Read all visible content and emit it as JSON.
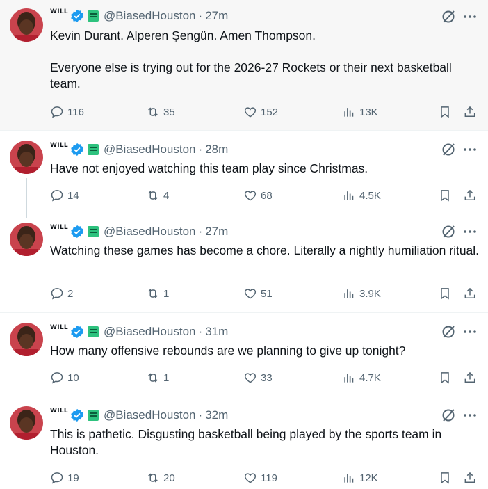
{
  "tweets": [
    {
      "display_name": "WILL",
      "handle": "@BiasedHouston",
      "separator": "·",
      "time": "27m",
      "text": "Kevin Durant. Alperen Şengün. Amen Thompson.\n\nEveryone else is trying out for the 2026-27 Rockets or their next basketball team.",
      "replies": "116",
      "retweets": "35",
      "likes": "152",
      "views": "13K"
    },
    {
      "display_name": "WILL",
      "handle": "@BiasedHouston",
      "separator": "·",
      "time": "28m",
      "text": "Have not enjoyed watching this team play since Christmas.",
      "replies": "14",
      "retweets": "4",
      "likes": "68",
      "views": "4.5K"
    },
    {
      "display_name": "WILL",
      "handle": "@BiasedHouston",
      "separator": "·",
      "time": "27m",
      "text": "Watching these games has become a chore. Literally a nightly humiliation ritual.",
      "replies": "2",
      "retweets": "1",
      "likes": "51",
      "views": "3.9K"
    },
    {
      "display_name": "WILL",
      "handle": "@BiasedHouston",
      "separator": "·",
      "time": "31m",
      "text": "How many offensive rebounds are we planning to give up tonight?",
      "replies": "10",
      "retweets": "1",
      "likes": "33",
      "views": "4.7K"
    },
    {
      "display_name": "WILL",
      "handle": "@BiasedHouston",
      "separator": "·",
      "time": "32m",
      "text": "This is pathetic. Disgusting basketball being played by the sports team in Houston.",
      "replies": "19",
      "retweets": "20",
      "likes": "119",
      "views": "12K"
    }
  ],
  "icons": {
    "verified": "verified-badge-icon",
    "affiliate": "kalshi-sports-affiliate-icon",
    "grok": "grok-icon",
    "more": "more-icon",
    "reply": "reply-icon",
    "retweet": "retweet-icon",
    "like": "heart-icon",
    "views": "views-icon",
    "bookmark": "bookmark-icon",
    "share": "share-icon"
  },
  "colors": {
    "verified_blue": "#1d9bf0",
    "affiliate_green": "#2ec27e",
    "secondary_text": "#536471",
    "highlight_bg": "#f7f7f7"
  }
}
